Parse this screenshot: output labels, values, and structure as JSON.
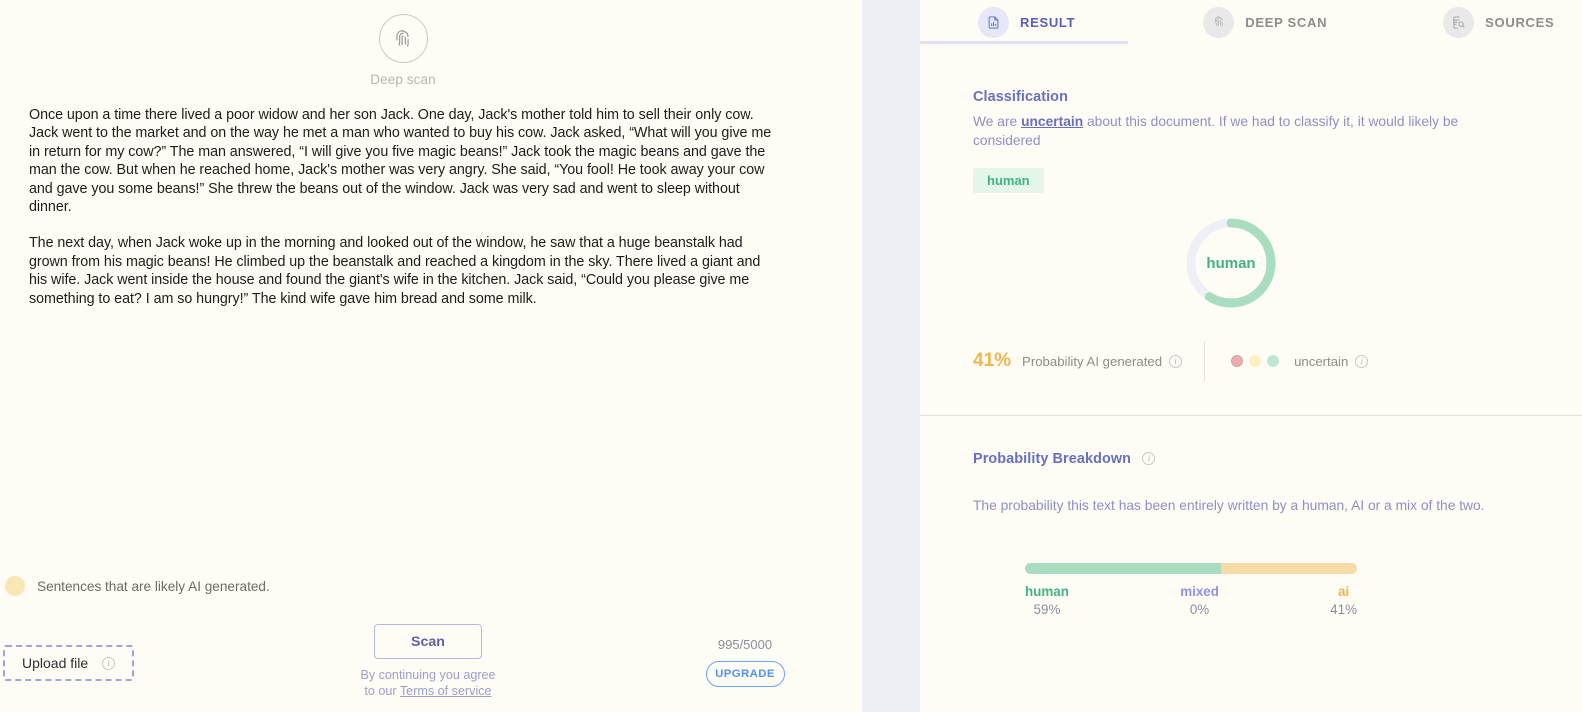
{
  "left": {
    "deep_scan": {
      "label": "Deep scan",
      "icon": "fingerprint-icon"
    },
    "document_paragraphs": [
      "Once upon a time there lived a poor widow and her son Jack. One day, Jack's mother told him to sell their only cow. Jack went to the market and on the way he met a man who wanted to buy his cow. Jack asked, “What will you give me in return for my cow?” The man answered, “I will give you five magic beans!” Jack took the magic beans and gave the man the cow. But when he reached home, Jack's mother was very angry. She said, “You fool! He took away your cow and gave you some beans!” She threw the beans out of the window. Jack was very sad and went to sleep without dinner.",
      "The next day, when Jack woke up in the morning and looked out of the window, he saw that a huge beanstalk had grown from his magic beans! He climbed up the beanstalk and reached a kingdom in the sky. There lived a giant and his wife. Jack went inside the house and found the giant's wife in the kitchen. Jack said, “Could you please give me something to eat? I am so hungry!” The kind wife gave him bread and some milk."
    ],
    "legend": {
      "text": "Sentences that are likely AI generated.",
      "color": "#fae6b5"
    },
    "upload": {
      "label": "Upload file",
      "info_icon": "info-icon"
    },
    "scan": {
      "label": "Scan"
    },
    "terms": {
      "line1": "By continuing you agree",
      "line2_prefix": "to our ",
      "link": "Terms of service"
    },
    "quota": {
      "count": "995/5000",
      "upgrade_label": "UPGRADE"
    }
  },
  "right": {
    "tabs": [
      {
        "label": "RESULT",
        "icon": "document-chart-icon",
        "active": true
      },
      {
        "label": "DEEP SCAN",
        "icon": "fingerprint-icon",
        "active": false
      },
      {
        "label": "SOURCES",
        "icon": "document-search-icon",
        "active": false
      }
    ],
    "classification": {
      "title": "Classification",
      "body_before": "We are ",
      "body_emphasis": "uncertain",
      "body_after": " about this document. If we had to classify it, it would likely be considered",
      "badge": "human",
      "donut_label": "human",
      "donut_human_percent": 59,
      "donut_color": "#a8ddc0",
      "donut_track_color": "#eef0f5",
      "stat_percent": "41%",
      "stat_label": "Probability AI generated",
      "status_label": "uncertain",
      "status_dots": [
        "#f3a9ae",
        "#faf0c0",
        "#bfe6d2"
      ]
    },
    "breakdown": {
      "title": "Probability Breakdown",
      "description": "The probability this text has been entirely written by a human, AI or a mix of the two."
    },
    "chart_data": {
      "type": "bar",
      "title": "Probability Breakdown",
      "categories": [
        "human",
        "mixed",
        "ai"
      ],
      "values": [
        59,
        0,
        41
      ],
      "value_labels": [
        "59%",
        "0%",
        "41%"
      ],
      "colors": [
        "#a8ddc0",
        "#c8cdf0",
        "#f7dca7"
      ],
      "label_colors": [
        "#3fb383",
        "#8b93e8",
        "#efb44e"
      ],
      "unit": "%",
      "ylim": [
        0,
        100
      ],
      "orientation": "horizontal-stacked",
      "grid": false,
      "legend": "below-bar"
    }
  }
}
